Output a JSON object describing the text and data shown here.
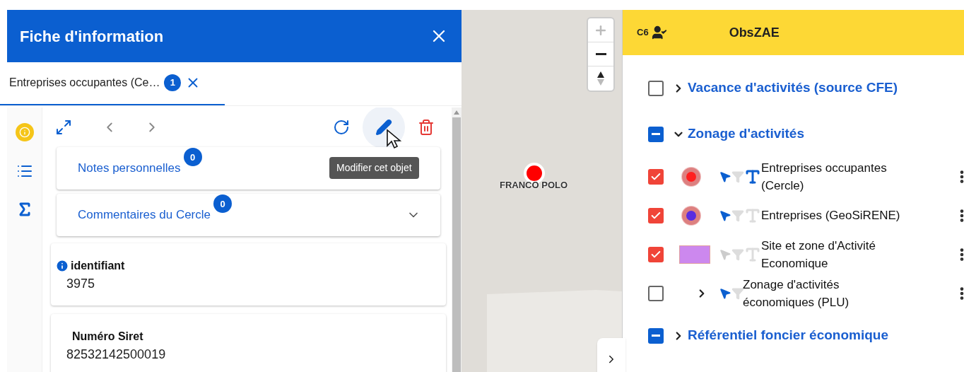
{
  "info_panel": {
    "title": "Fiche d'information",
    "tabs": [
      {
        "label": "Entreprises occupantes (Ce…",
        "count": "1",
        "selected": true
      }
    ],
    "tooltip": "Modifier cet objet",
    "sections": [
      {
        "label": "Notes personnelles",
        "count": "0"
      },
      {
        "label": "Commentaires du Cercle",
        "count": "0",
        "expanded": false
      }
    ],
    "fields": [
      {
        "label": "identifiant",
        "value": "3975",
        "info": true
      },
      {
        "label": "Numéro Siret",
        "value": "82532142500019",
        "info": false
      }
    ]
  },
  "map": {
    "marker_label": "FRANCO POLO"
  },
  "layer_panel": {
    "code": "C6",
    "title": "ObsZAE",
    "groups": [
      {
        "label": "Vacance d'activités (source CFE)",
        "checked": false,
        "partial": false,
        "expanded": false
      },
      {
        "label": "Zonage d'activités",
        "checked": false,
        "partial": true,
        "expanded": true,
        "layers": [
          {
            "label": "Entreprises occupantes (Cercle)",
            "checked": true,
            "kind": "point",
            "color": "#ff2020",
            "selectable": true,
            "labels": true
          },
          {
            "label": "Entreprises (GeoSiRENE)",
            "checked": true,
            "kind": "point",
            "color": "#5b2de0",
            "selectable": true,
            "labels": false
          },
          {
            "label": "Site et zone d'Activité Economique",
            "checked": true,
            "kind": "polygon",
            "color": "#cc88ee",
            "selectable": false,
            "labels": false
          },
          {
            "label": "Zonage d'activités économiques (PLU)",
            "checked": false,
            "kind": "group",
            "selectable": true
          }
        ]
      },
      {
        "label": "Référentiel foncier économique",
        "checked": false,
        "partial": true,
        "expanded": false
      }
    ]
  }
}
